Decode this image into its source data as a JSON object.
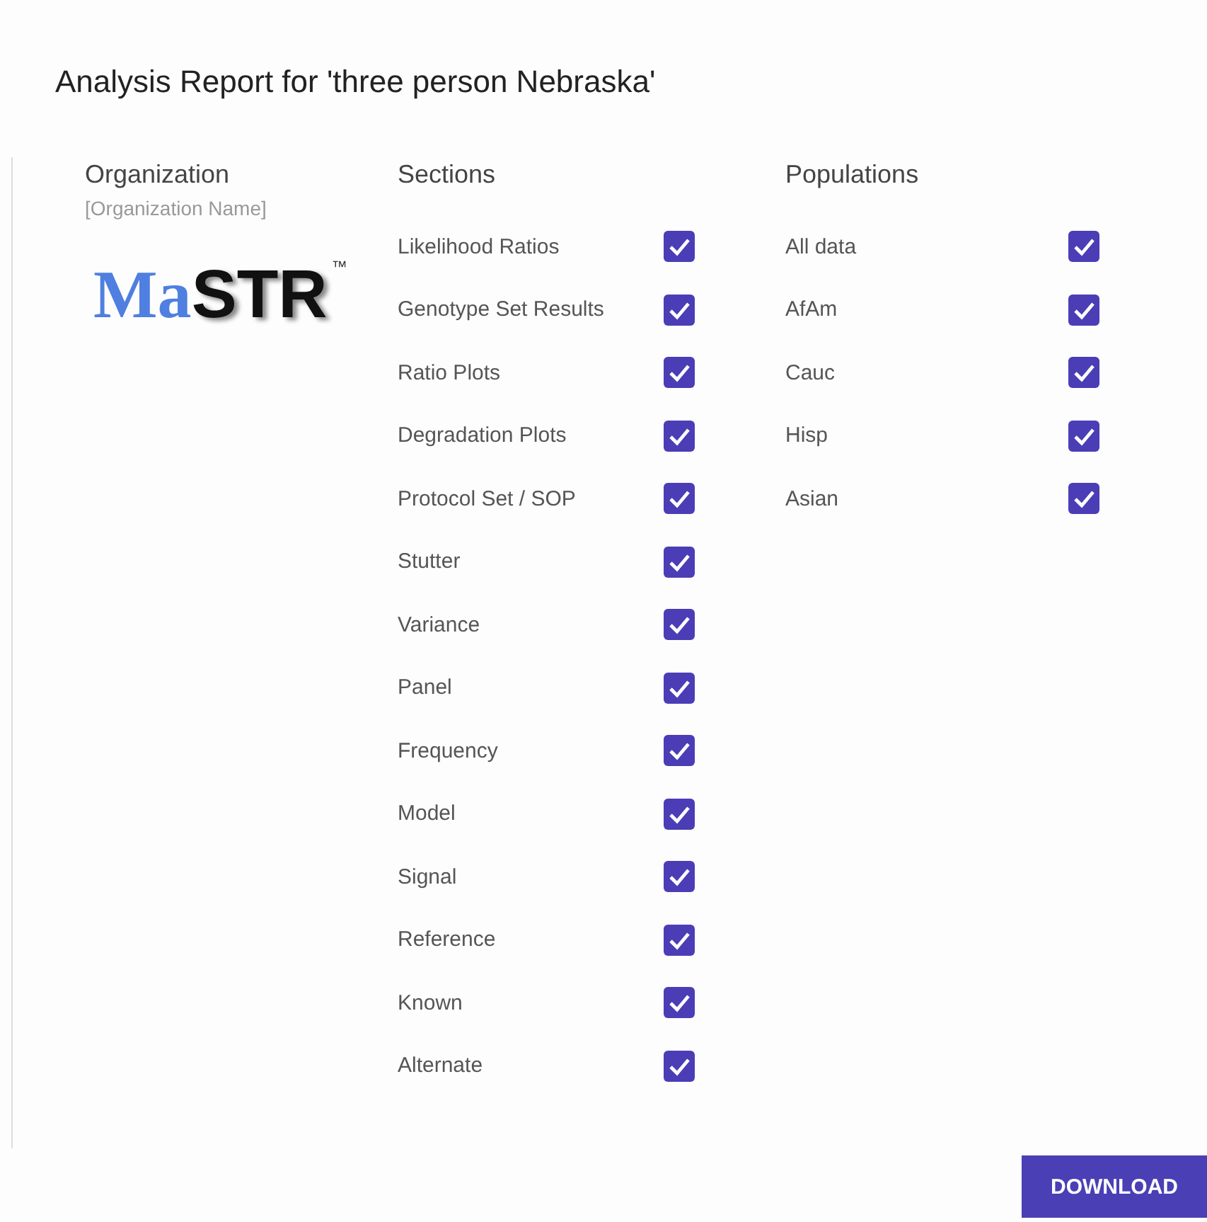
{
  "title": "Analysis Report for 'three person Nebraska'",
  "organization": {
    "heading": "Organization",
    "name": "[Organization Name]",
    "logo": {
      "first": "Ma",
      "second": "STR",
      "mark": "™"
    }
  },
  "sections": {
    "heading": "Sections",
    "items": [
      {
        "label": "Likelihood Ratios",
        "checked": true
      },
      {
        "label": "Genotype Set Results",
        "checked": true
      },
      {
        "label": "Ratio Plots",
        "checked": true
      },
      {
        "label": "Degradation Plots",
        "checked": true
      },
      {
        "label": "Protocol Set / SOP",
        "checked": true
      },
      {
        "label": "Stutter",
        "checked": true
      },
      {
        "label": "Variance",
        "checked": true
      },
      {
        "label": "Panel",
        "checked": true
      },
      {
        "label": "Frequency",
        "checked": true
      },
      {
        "label": "Model",
        "checked": true
      },
      {
        "label": "Signal",
        "checked": true
      },
      {
        "label": "Reference",
        "checked": true
      },
      {
        "label": "Known",
        "checked": true
      },
      {
        "label": "Alternate",
        "checked": true
      }
    ]
  },
  "populations": {
    "heading": "Populations",
    "items": [
      {
        "label": "All data",
        "checked": true
      },
      {
        "label": "AfAm",
        "checked": true
      },
      {
        "label": "Cauc",
        "checked": true
      },
      {
        "label": "Hisp",
        "checked": true
      },
      {
        "label": "Asian",
        "checked": true
      }
    ]
  },
  "buttons": [
    "DOWNLOAD"
  ]
}
